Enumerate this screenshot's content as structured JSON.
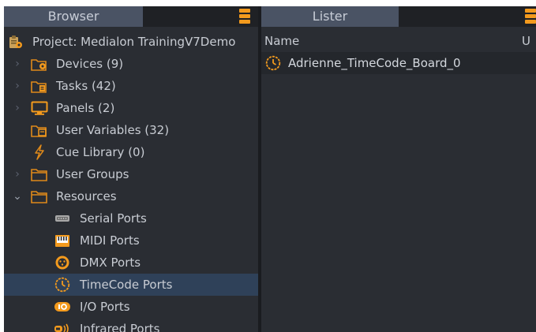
{
  "browser": {
    "title": "Browser",
    "tree": [
      {
        "label": "Project: Medialon TrainingV7Demo",
        "icon": "project-icon"
      },
      {
        "label": "Devices (9)",
        "icon": "devices-folder-icon"
      },
      {
        "label": "Tasks (42)",
        "icon": "tasks-folder-icon"
      },
      {
        "label": "Panels (2)",
        "icon": "panel-monitor-icon"
      },
      {
        "label": "User Variables (32)",
        "icon": "user-variables-folder-icon"
      },
      {
        "label": "Cue Library (0)",
        "icon": "cue-lightning-icon"
      },
      {
        "label": "User Groups",
        "icon": "folder-icon"
      },
      {
        "label": "Resources",
        "icon": "folder-icon"
      },
      {
        "label": "Serial Ports",
        "icon": "serial-port-icon"
      },
      {
        "label": "MIDI Ports",
        "icon": "midi-port-icon"
      },
      {
        "label": "DMX Ports",
        "icon": "dmx-port-icon"
      },
      {
        "label": "TimeCode Ports",
        "icon": "timecode-clock-icon"
      },
      {
        "label": "I/O Ports",
        "icon": "io-port-icon"
      },
      {
        "label": "Infrared Ports",
        "icon": "infrared-port-icon"
      }
    ]
  },
  "lister": {
    "title": "Lister",
    "columns": {
      "name": "Name",
      "second": "U"
    },
    "rows": [
      {
        "name": "Adrienne_TimeCode_Board_0",
        "icon": "timecode-clock-icon"
      }
    ]
  },
  "colors": {
    "accent": "#f39a1d",
    "selected_row": "#2f4159",
    "panel_bg": "#2a2d33",
    "tab_bg": "#4a5364"
  }
}
